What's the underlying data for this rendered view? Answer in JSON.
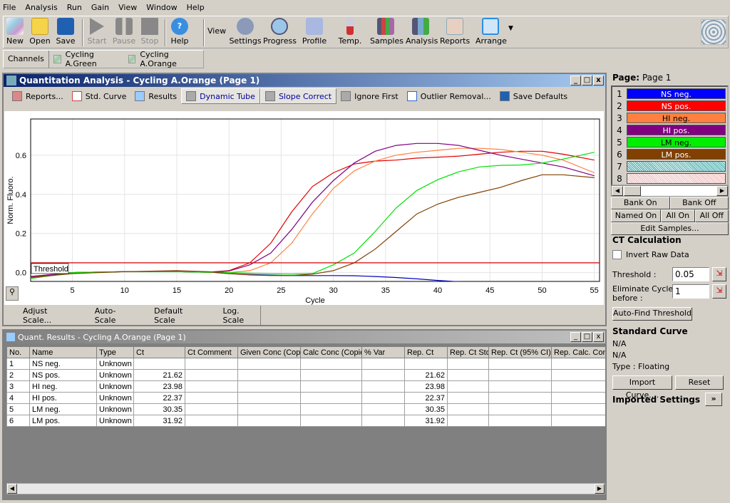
{
  "menu": [
    "File",
    "Analysis",
    "Run",
    "Gain",
    "View",
    "Window",
    "Help"
  ],
  "toolbar": {
    "new": "New",
    "open": "Open",
    "save": "Save",
    "start": "Start",
    "pause": "Pause",
    "stop": "Stop",
    "help": "Help",
    "view": "View",
    "settings": "Settings",
    "progress": "Progress",
    "profile": "Profile",
    "temp": "Temp.",
    "samples": "Samples",
    "analysis": "Analysis",
    "reports": "Reports",
    "arrange": "Arrange",
    "logo": "QIAGEN"
  },
  "channels": {
    "label": "Channels",
    "items": [
      "Cycling A.Green",
      "Cycling A.Orange"
    ]
  },
  "analysis_window": {
    "title": "Quantitation Analysis - Cycling A.Orange (Page 1)",
    "tools": [
      "Reports...",
      "Std. Curve",
      "Results",
      "Dynamic Tube",
      "Slope Correct",
      "Ignore First",
      "Outlier Removal...",
      "Save Defaults"
    ],
    "scale_buttons": [
      "Adjust Scale...",
      "Auto-Scale",
      "Default Scale",
      "Log. Scale"
    ]
  },
  "chart_data": {
    "type": "line",
    "xlabel": "Cycle",
    "ylabel": "Norm. Fluoro.",
    "xlim": [
      1,
      55.5
    ],
    "ylim": [
      -0.045,
      0.785
    ],
    "xticks": [
      5,
      10,
      15,
      20,
      25,
      30,
      35,
      40,
      45,
      50,
      55
    ],
    "yticks": [
      0.0,
      0.2,
      0.4,
      0.6
    ],
    "grid": true,
    "threshold": {
      "label": "Threshold",
      "value": 0.05,
      "color": "#d00000"
    },
    "x": [
      1,
      5,
      10,
      15,
      18,
      20,
      22,
      24,
      26,
      28,
      30,
      32,
      34,
      36,
      38,
      40,
      42,
      44,
      46,
      48,
      50,
      52,
      55
    ],
    "series": [
      {
        "name": "NS neg.",
        "color": "#0000c0",
        "values": [
          -0.02,
          0,
          0.005,
          0.005,
          0.003,
          -0.005,
          -0.01,
          -0.013,
          -0.015,
          -0.015,
          -0.015,
          -0.016,
          -0.02,
          -0.025,
          -0.032,
          -0.04,
          -0.047,
          null,
          null,
          null,
          null,
          null,
          null
        ]
      },
      {
        "name": "NS pos.",
        "color": "#e00000",
        "values": [
          -0.02,
          0,
          0.005,
          0.005,
          0.002,
          0.01,
          0.05,
          0.15,
          0.31,
          0.44,
          0.51,
          0.555,
          0.57,
          0.575,
          0.585,
          0.59,
          0.595,
          0.605,
          0.615,
          0.62,
          0.62,
          0.605,
          0.575
        ]
      },
      {
        "name": "HI neg.",
        "color": "#ff8040",
        "values": [
          -0.02,
          0,
          0.005,
          0.005,
          0.002,
          0.0,
          0.01,
          0.05,
          0.15,
          0.3,
          0.43,
          0.52,
          0.57,
          0.6,
          0.615,
          0.625,
          0.635,
          0.635,
          0.63,
          0.615,
          0.6,
          0.575,
          0.51
        ]
      },
      {
        "name": "HI pos.",
        "color": "#800080",
        "values": [
          -0.02,
          0,
          0.005,
          0.005,
          0.002,
          0.008,
          0.04,
          0.1,
          0.22,
          0.36,
          0.47,
          0.56,
          0.62,
          0.65,
          0.66,
          0.66,
          0.65,
          0.625,
          0.6,
          0.58,
          0.56,
          0.54,
          0.495
        ]
      },
      {
        "name": "LM neg.",
        "color": "#00e000",
        "values": [
          -0.03,
          0,
          0.005,
          0.005,
          0.002,
          0.0,
          -0.003,
          -0.006,
          -0.007,
          -0.005,
          0.04,
          0.1,
          0.21,
          0.33,
          0.42,
          0.475,
          0.515,
          0.54,
          0.548,
          0.55,
          0.56,
          0.58,
          0.615
        ]
      },
      {
        "name": "LM pos.",
        "color": "#804000",
        "values": [
          -0.025,
          -0.005,
          0.005,
          0.01,
          0.005,
          -0.005,
          -0.012,
          -0.015,
          -0.015,
          -0.008,
          0.01,
          0.05,
          0.12,
          0.21,
          0.3,
          0.35,
          0.385,
          0.41,
          0.435,
          0.47,
          0.5,
          0.5,
          0.485
        ]
      }
    ]
  },
  "results_window": {
    "title": "Quant. Results - Cycling A.Orange (Page 1)",
    "columns": [
      "No.",
      "Name",
      "Type",
      "Ct",
      "Ct Comment",
      "Given Conc (Cop",
      "Calc Conc (Copie",
      "% Var",
      "Rep. Ct",
      "Rep. Ct Std",
      "Rep. Ct (95% CI)",
      "Rep. Calc. Con"
    ],
    "rows": [
      [
        "1",
        "NS neg.",
        "Unknown",
        "",
        "",
        "",
        "",
        "",
        "",
        "",
        "",
        ""
      ],
      [
        "2",
        "NS pos.",
        "Unknown",
        "21.62",
        "",
        "",
        "",
        "",
        "21.62",
        "",
        "",
        ""
      ],
      [
        "3",
        "HI neg.",
        "Unknown",
        "23.98",
        "",
        "",
        "",
        "",
        "23.98",
        "",
        "",
        ""
      ],
      [
        "4",
        "HI pos.",
        "Unknown",
        "22.37",
        "",
        "",
        "",
        "",
        "22.37",
        "",
        "",
        ""
      ],
      [
        "5",
        "LM neg.",
        "Unknown",
        "30.35",
        "",
        "",
        "",
        "",
        "30.35",
        "",
        "",
        ""
      ],
      [
        "6",
        "LM pos.",
        "Unknown",
        "31.92",
        "",
        "",
        "",
        "",
        "31.92",
        "",
        "",
        ""
      ]
    ]
  },
  "right_panel": {
    "page_label": "Page:",
    "page_value": "Page 1",
    "samples": [
      {
        "num": "1",
        "name": "NS neg.",
        "color": "#0000ff",
        "text": "#ffffff"
      },
      {
        "num": "2",
        "name": "NS pos.",
        "color": "#ff0000",
        "text": "#ffffff"
      },
      {
        "num": "3",
        "name": "HI neg.",
        "color": "#ff8040",
        "text": "#000000"
      },
      {
        "num": "4",
        "name": "HI pos.",
        "color": "#800080",
        "text": "#ffffff"
      },
      {
        "num": "5",
        "name": "LM neg.",
        "color": "#00ee00",
        "text": "#000000"
      },
      {
        "num": "6",
        "name": "LM pos.",
        "color": "#804000",
        "text": "#ffffff"
      },
      {
        "num": "7",
        "name": "",
        "color": "#3aa6a6",
        "text": "#000000"
      },
      {
        "num": "8",
        "name": "",
        "color": "#f0b8b8",
        "text": "#000000"
      }
    ],
    "bank_on": "Bank On",
    "bank_off": "Bank Off",
    "named_on": "Named On",
    "all_on": "All On",
    "all_off": "All Off",
    "edit_samples": "Edit Samples...",
    "ct_title": "CT Calculation",
    "invert_raw": "Invert Raw Data",
    "invert_checked": false,
    "threshold_label": "Threshold :",
    "threshold_value": "0.05",
    "eliminate_label1": "Eliminate Cycles",
    "eliminate_label2": "before :",
    "eliminate_value": "1",
    "auto_find": "Auto-Find Threshold",
    "std_title": "Standard Curve",
    "std_line1": "N/A",
    "std_line2": "N/A",
    "std_type": "Type : Floating",
    "import_curve": "Import Curve....",
    "reset": "Reset",
    "imported_settings": "Imported Settings",
    "expand": "»"
  }
}
